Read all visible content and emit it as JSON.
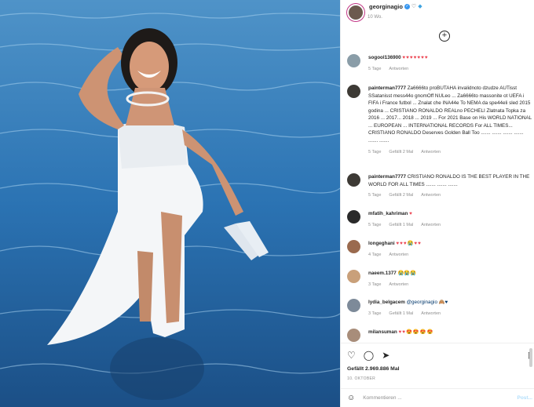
{
  "header": {
    "username": "georginagio",
    "verified": "✓",
    "time": "10 Wo."
  },
  "comments": [
    {
      "user": "sogool136900",
      "text": "",
      "emoji": "♥♥♥♥♥♥♥",
      "age": "5 Tage",
      "likes": "",
      "reply": "Antworten"
    },
    {
      "user": "painterman7777",
      "text": "Za6666to proBUTAHA invalidnoto dzudze AUTisst SSatanisst mess44o gnomOff NULeo ... Za6666to massonite ot UEFA i FIFA i France futbol ... Znalat che INA44e To NEMA da spe44eli sled 2015 godina ... CRISTIANO RONALDO REALno PECHELI Zlatnata Topka za 2016 ... 2017... 2018 ... 2019 ... For 2021 Base on His WORLD NATIONAL ... EUROPEAN ... INTERNATIONAL RECORDS For ALL TIMES... CRISTIANO RONALDO Deserves Golden Ball Too ....... ....... ....... ....... ....... .......",
      "emoji": "",
      "age": "5 Tage",
      "likes": "Gefällt 2 Mal",
      "reply": "Antworten"
    },
    {
      "user": "painterman7777",
      "text": "CRISTIANO RONALDO IS THE BEST PLAYER IN THE WORLD FOR ALL TIMES ....... ....... .......",
      "emoji": "",
      "age": "5 Tage",
      "likes": "Gefällt 2 Mal",
      "reply": "Antworten"
    },
    {
      "user": "mfatih_kahriman",
      "text": "",
      "emoji": "♥",
      "age": "5 Tage",
      "likes": "Gefällt 1 Mal",
      "reply": "Antworten"
    },
    {
      "user": "longeghani",
      "text": "",
      "emoji": "♥♥♥😭♥♥",
      "age": "4 Tage",
      "likes": "",
      "reply": "Antworten"
    },
    {
      "user": "naeem.1377",
      "text": "",
      "emoji": "😭😭😭",
      "age": "3 Tage",
      "likes": "",
      "reply": "Antworten"
    },
    {
      "user": "lydia_belgacem",
      "text": "@georginagio 🙈♥",
      "emoji": "",
      "age": "3 Tage",
      "likes": "Gefällt 1 Mal",
      "reply": "Antworten"
    },
    {
      "user": "milansuman",
      "text": "",
      "emoji": "♥♥😍😍😍😍",
      "age": "",
      "likes": "",
      "reply": ""
    }
  ],
  "likes_count": "Gefällt 2.969.886 Mal",
  "date": "10. OKTOBER",
  "comment_placeholder": "Kommentieren ...",
  "post_label": "Post..."
}
